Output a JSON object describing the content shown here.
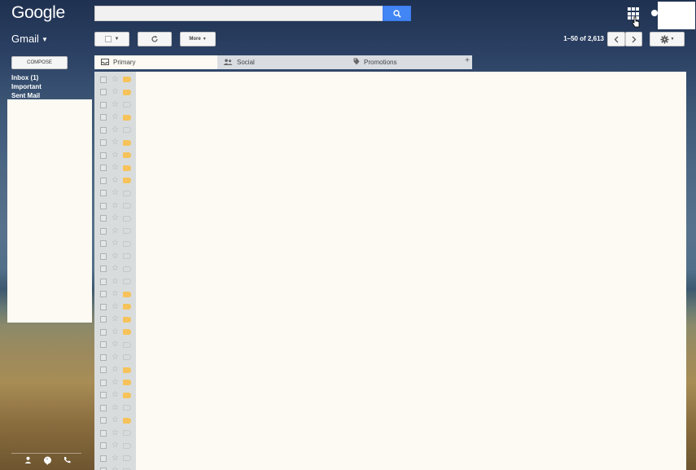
{
  "header": {
    "logo_text": "Google",
    "search": {
      "value": "",
      "placeholder": ""
    },
    "search_icon": "search-icon",
    "apps_icon": "apps-grid-icon"
  },
  "toolbar": {
    "gmail_label": "Gmail",
    "more_label": "More",
    "page_info": "1–50 of 2,613",
    "refresh_icon": "refresh-icon",
    "settings_icon": "gear-icon"
  },
  "sidebar": {
    "compose_label": "COMPOSE",
    "items": [
      {
        "label": "Inbox (1)"
      },
      {
        "label": "Important"
      },
      {
        "label": "Sent Mail"
      }
    ]
  },
  "tabs": [
    {
      "label": "Primary",
      "icon": "inbox-icon"
    },
    {
      "label": "Social",
      "icon": "people-icon"
    },
    {
      "label": "Promotions",
      "icon": "tag-icon"
    }
  ],
  "messages": {
    "important_flags": [
      1,
      1,
      0,
      1,
      0,
      1,
      1,
      1,
      1,
      0,
      0,
      0,
      0,
      0,
      0,
      0,
      0,
      1,
      1,
      1,
      1,
      0,
      0,
      1,
      1,
      1,
      0,
      1,
      0,
      0,
      0,
      0
    ]
  },
  "colors": {
    "important": "#f5c35a",
    "search_button": "#4285f4"
  }
}
